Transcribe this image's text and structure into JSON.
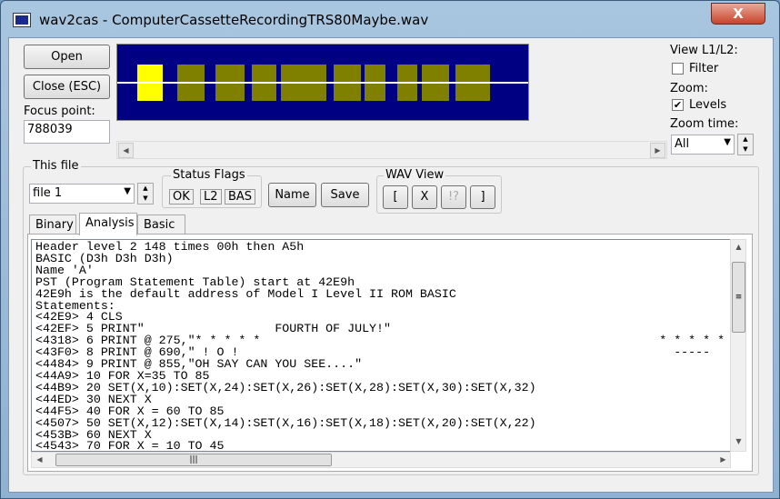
{
  "window": {
    "title": "wav2cas - ComputerCassetteRecordingTRS80Maybe.wav",
    "close": "X"
  },
  "left": {
    "open": "Open",
    "close": "Close (ESC)",
    "focus_label": "Focus point:",
    "focus_value": "788039"
  },
  "right": {
    "view_label": "View L1/L2:",
    "filter": "Filter",
    "filter_checked": false,
    "zoom_label": "Zoom:",
    "levels": "Levels",
    "levels_checked": true,
    "zoom_time_label": "Zoom time:",
    "zoom_time_value": "All"
  },
  "colors": {
    "wave_bg": "#000082",
    "wave": "#808000",
    "highlight": "#ffff00"
  },
  "file": {
    "group_label": "This file",
    "select_value": "file 1",
    "status_label": "Status Flags",
    "flags": [
      "OK",
      "L2",
      "BAS"
    ],
    "name_btn": "Name",
    "save_btn": "Save",
    "wav_label": "WAV View",
    "wav_btns": [
      "[",
      "X",
      "!?",
      "]"
    ]
  },
  "tabs": [
    {
      "label": "Binary"
    },
    {
      "label": "Analysis",
      "active": true
    },
    {
      "label": "Basic"
    }
  ],
  "analysis_lines": [
    "Header level 2 148 times 00h then A5h",
    "BASIC (D3h D3h D3h)",
    "Name 'A'",
    "PST (Program Statement Table) start at 42E9h",
    "42E9h is the default address of Model I Level II ROM BASIC",
    "Statements:",
    "<42E9> 4 CLS",
    "<42EF> 5 PRINT\"                  FOURTH OF JULY!\"",
    "<4318> 6 PRINT @ 275,\"* * * * *                                                       * * * * *",
    "<43F0> 8 PRINT @ 690,\" ! O !                                                            -----",
    "<4484> 9 PRINT @ 855,\"OH SAY CAN YOU SEE....\"",
    "<44A9> 10 FOR X=35 TO 85",
    "<44B9> 20 SET(X,10):SET(X,24):SET(X,26):SET(X,28):SET(X,30):SET(X,32)",
    "<44ED> 30 NEXT X",
    "<44F5> 40 FOR X = 60 TO 85",
    "<4507> 50 SET(X,12):SET(X,14):SET(X,16):SET(X,18):SET(X,20):SET(X,22)",
    "<453B> 60 NEXT X",
    "<4543> 70 FOR X = 10 TO 45"
  ]
}
